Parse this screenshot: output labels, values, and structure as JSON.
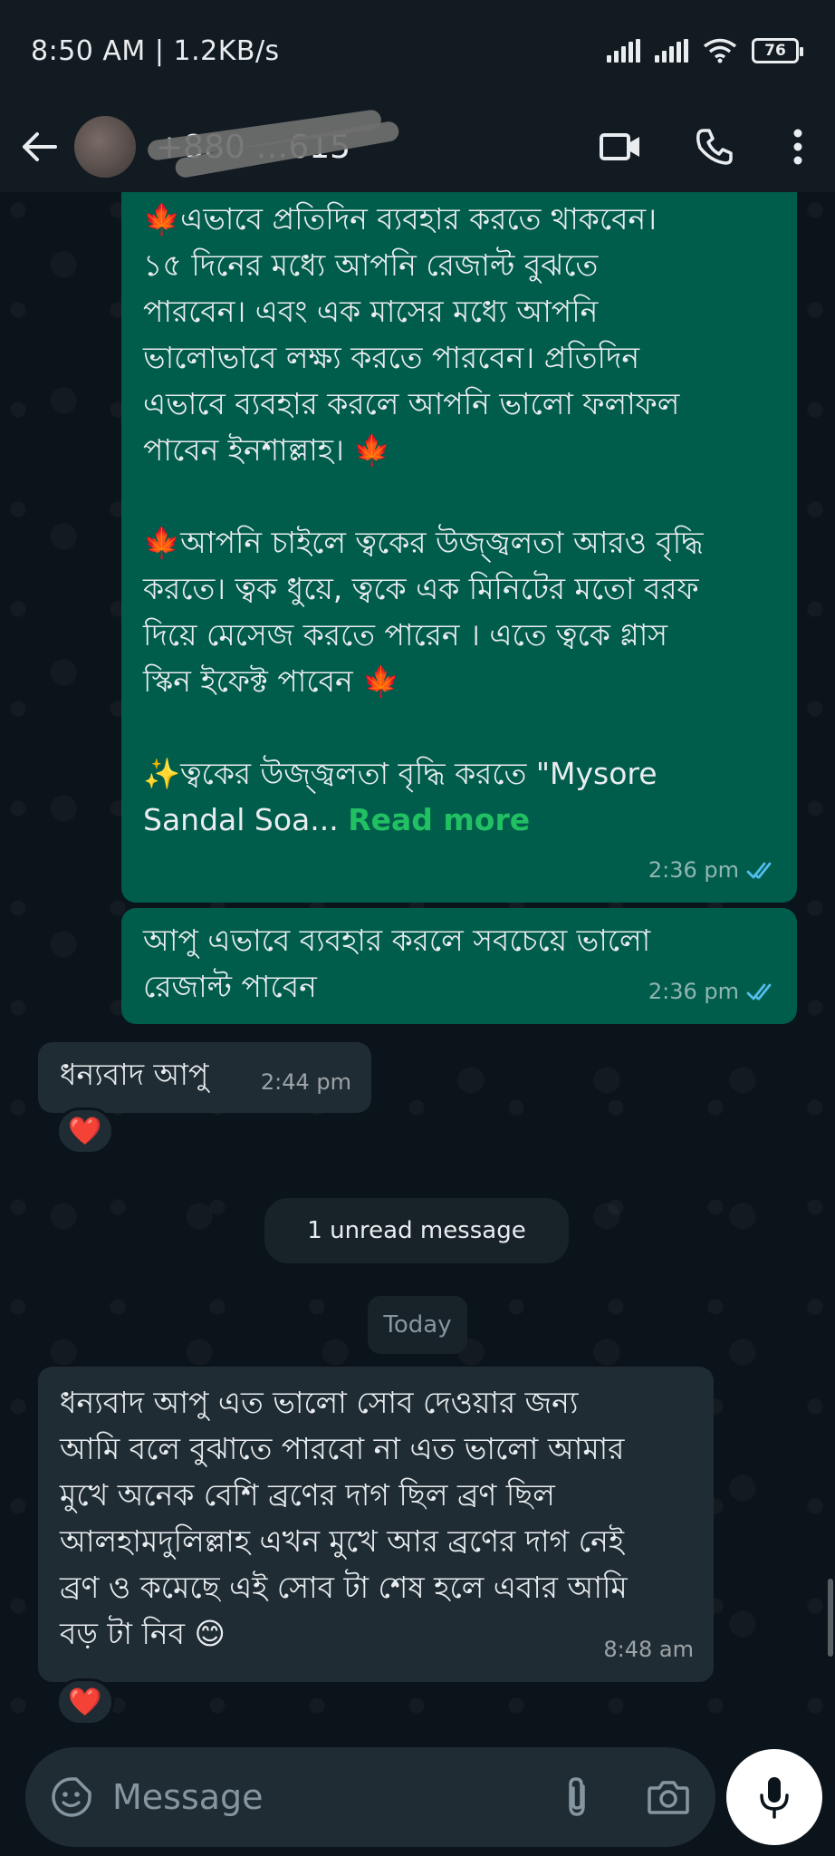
{
  "status_bar": {
    "time_speed": "8:50 AM | 1.2KB/s",
    "battery": "76"
  },
  "header": {
    "contact_name": "+880 …615",
    "back_icon": "arrow-left-icon",
    "video_icon": "video-camera-icon",
    "call_icon": "phone-icon",
    "menu_icon": "more-vertical-icon"
  },
  "messages": [
    {
      "direction": "outgoing",
      "lines": [
        "🍁এভাবে প্রতিদিন ব্যবহার করতে থাকবেন।",
        "১৫ দিনের মধ্যে আপনি  রেজাল্ট বুঝতে",
        "পারবেন। এবং এক মাসের মধ্যে আপনি",
        "ভালোভাবে লক্ষ্য করতে পারবেন।  প্রতিদিন",
        "এভাবে ব্যবহার করলে আপনি ভালো ফলাফল",
        "পাবেন ইনশাল্লাহ। 🍁",
        "",
        "🍁আপনি চাইলে ত্বকের উজ্জ্বলতা আরও বৃদ্ধি",
        "করতে। ত্বক ধুয়ে, ত্বকে এক মিনিটের মতো বরফ",
        "দিয়ে মেসেজ করতে পারেন । এতে ত্বকে গ্লাস",
        "স্কিন ইফেক্ট পাবেন 🍁",
        "",
        "✨ত্বকের উজ্জ্বলতা বৃদ্ধি করতে \"Mysore"
      ],
      "last_line": "Sandal Soa...",
      "read_more": "Read more",
      "time": "2:36 pm"
    },
    {
      "direction": "outgoing",
      "lines": [
        "আপু এভাবে ব্যবহার করলে সবচেয়ে ভালো",
        "রেজাল্ট পাবেন"
      ],
      "time": "2:36 pm"
    },
    {
      "direction": "incoming",
      "lines": [
        "ধন্যবাদ আপু"
      ],
      "time": "2:44 pm",
      "reaction": "❤️"
    },
    {
      "direction": "incoming",
      "lines": [
        "ধন্যবাদ আপু এত ভালো সোব দেওয়ার জন্য",
        "আমি বলে বুঝাতে পারবো না এত ভালো আমার",
        "মুখে অনেক বেশি ব্রণের দাগ ছিল ব্রণ ছিল",
        "আলহামদুলিল্লাহ এখন মুখে আর ব্রণের দাগ নেই",
        "ব্রণ ও কমেছে এই সোব টা শেষ হলে এবার আমি",
        "বড় টা নিব 😊"
      ],
      "time": "8:48 am",
      "reaction": "❤️"
    }
  ],
  "unread_banner": "1 unread message",
  "date_divider": "Today",
  "composer": {
    "placeholder": "Message",
    "emoji_icon": "sticker-emoji-icon",
    "attach_icon": "paperclip-icon",
    "camera_icon": "camera-icon",
    "mic_icon": "microphone-icon"
  },
  "colors": {
    "background": "#0b141a",
    "outgoing_bubble": "#005c4b",
    "incoming_bubble": "#202c33",
    "read_ticks": "#53bdeb",
    "read_more": "#21c063"
  }
}
